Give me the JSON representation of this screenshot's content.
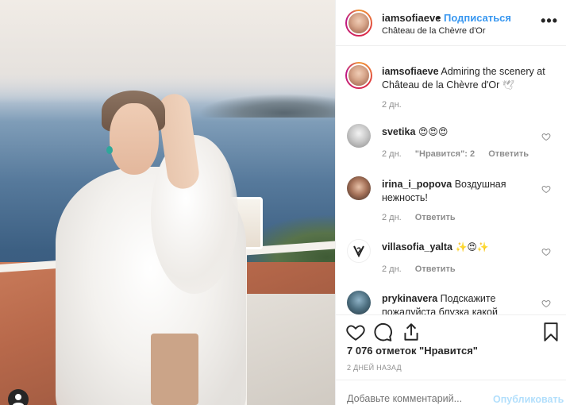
{
  "post": {
    "username": "iamsofiaeve",
    "follow_label": "Подписаться",
    "dot": "•",
    "location": "Château de la Chèvre d'Or",
    "more_label": "•••"
  },
  "caption": {
    "username": "iamsofiaeve",
    "text": "Admiring the scenery at Château de la Chèvre d'Or",
    "emoji": "🕊",
    "time": "2 дн."
  },
  "comments": [
    {
      "username": "svetika",
      "text": "😍😍😍",
      "time": "2 дн.",
      "likes": "\"Нравится\": 2",
      "reply": "Ответить"
    },
    {
      "username": "irina_i_popova",
      "text": "Воздушная нежность!",
      "time": "2 дн.",
      "reply": "Ответить"
    },
    {
      "username": "villasofia_yalta",
      "text": "✨😍✨",
      "time": "2 дн.",
      "reply": "Ответить"
    },
    {
      "username": "prykinavera",
      "text": "Подскажите пожалуйста блузка какой"
    }
  ],
  "likes_text": "7 076 отметок \"Нравится\"",
  "posted_ago": "2 ДНЕЙ НАЗАД",
  "comment_box": {
    "placeholder": "Добавьте комментарий...",
    "post_label": "Опубликовать"
  },
  "colors": {
    "link": "#3897f0",
    "muted": "#8e8e8e",
    "post_disabled": "#b2dffc"
  },
  "icons": [
    "user-tag-icon",
    "more-icon",
    "heart-icon",
    "comment-icon",
    "share-icon",
    "bookmark-icon"
  ]
}
